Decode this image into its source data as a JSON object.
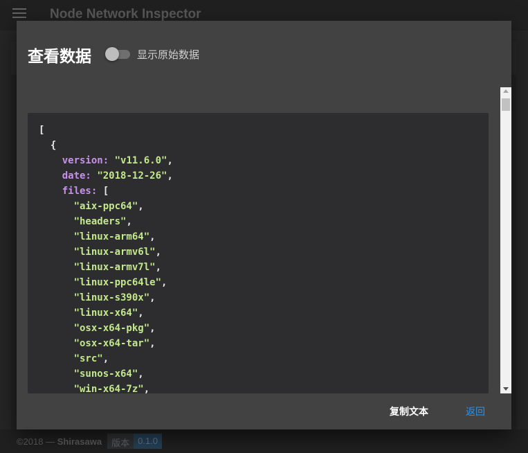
{
  "app": {
    "title": "Node Network Inspector"
  },
  "footer": {
    "copyright_prefix": "©2018 — ",
    "author": "Shirasawa",
    "version_label": "版本",
    "version_value": "0.1.0"
  },
  "dialog": {
    "title": "查看数据",
    "raw_toggle_label": "显示原始数据",
    "raw_toggle_on": false,
    "copy_button": "复制文本",
    "back_button": "返回"
  },
  "code_lines": [
    {
      "indent": "",
      "parts": [
        {
          "t": "pun",
          "v": "["
        }
      ]
    },
    {
      "indent": "  ",
      "parts": [
        {
          "t": "pun",
          "v": "{"
        }
      ]
    },
    {
      "indent": "    ",
      "parts": [
        {
          "t": "key",
          "v": "version:"
        },
        {
          "t": "pun",
          "v": " "
        },
        {
          "t": "str",
          "v": "\"v11.6.0\""
        },
        {
          "t": "pun",
          "v": ","
        }
      ]
    },
    {
      "indent": "    ",
      "parts": [
        {
          "t": "key",
          "v": "date:"
        },
        {
          "t": "pun",
          "v": " "
        },
        {
          "t": "str",
          "v": "\"2018-12-26\""
        },
        {
          "t": "pun",
          "v": ","
        }
      ]
    },
    {
      "indent": "    ",
      "parts": [
        {
          "t": "key",
          "v": "files:"
        },
        {
          "t": "pun",
          "v": " ["
        }
      ]
    },
    {
      "indent": "      ",
      "parts": [
        {
          "t": "str",
          "v": "\"aix-ppc64\""
        },
        {
          "t": "pun",
          "v": ","
        }
      ]
    },
    {
      "indent": "      ",
      "parts": [
        {
          "t": "str",
          "v": "\"headers\""
        },
        {
          "t": "pun",
          "v": ","
        }
      ]
    },
    {
      "indent": "      ",
      "parts": [
        {
          "t": "str",
          "v": "\"linux-arm64\""
        },
        {
          "t": "pun",
          "v": ","
        }
      ]
    },
    {
      "indent": "      ",
      "parts": [
        {
          "t": "str",
          "v": "\"linux-armv6l\""
        },
        {
          "t": "pun",
          "v": ","
        }
      ]
    },
    {
      "indent": "      ",
      "parts": [
        {
          "t": "str",
          "v": "\"linux-armv7l\""
        },
        {
          "t": "pun",
          "v": ","
        }
      ]
    },
    {
      "indent": "      ",
      "parts": [
        {
          "t": "str",
          "v": "\"linux-ppc64le\""
        },
        {
          "t": "pun",
          "v": ","
        }
      ]
    },
    {
      "indent": "      ",
      "parts": [
        {
          "t": "str",
          "v": "\"linux-s390x\""
        },
        {
          "t": "pun",
          "v": ","
        }
      ]
    },
    {
      "indent": "      ",
      "parts": [
        {
          "t": "str",
          "v": "\"linux-x64\""
        },
        {
          "t": "pun",
          "v": ","
        }
      ]
    },
    {
      "indent": "      ",
      "parts": [
        {
          "t": "str",
          "v": "\"osx-x64-pkg\""
        },
        {
          "t": "pun",
          "v": ","
        }
      ]
    },
    {
      "indent": "      ",
      "parts": [
        {
          "t": "str",
          "v": "\"osx-x64-tar\""
        },
        {
          "t": "pun",
          "v": ","
        }
      ]
    },
    {
      "indent": "      ",
      "parts": [
        {
          "t": "str",
          "v": "\"src\""
        },
        {
          "t": "pun",
          "v": ","
        }
      ]
    },
    {
      "indent": "      ",
      "parts": [
        {
          "t": "str",
          "v": "\"sunos-x64\""
        },
        {
          "t": "pun",
          "v": ","
        }
      ]
    },
    {
      "indent": "      ",
      "parts": [
        {
          "t": "str",
          "v": "\"win-x64-7z\""
        },
        {
          "t": "pun",
          "v": ","
        }
      ]
    }
  ],
  "colors": {
    "key": "#c792ea",
    "string": "#c3e88d",
    "accent": "#2196f3",
    "dialog_bg": "#424242",
    "code_bg": "#2d2d30"
  },
  "icons": {
    "menu": "menu-icon",
    "scroll_up": "scroll-up-arrow-icon",
    "scroll_down": "scroll-down-arrow-icon"
  }
}
